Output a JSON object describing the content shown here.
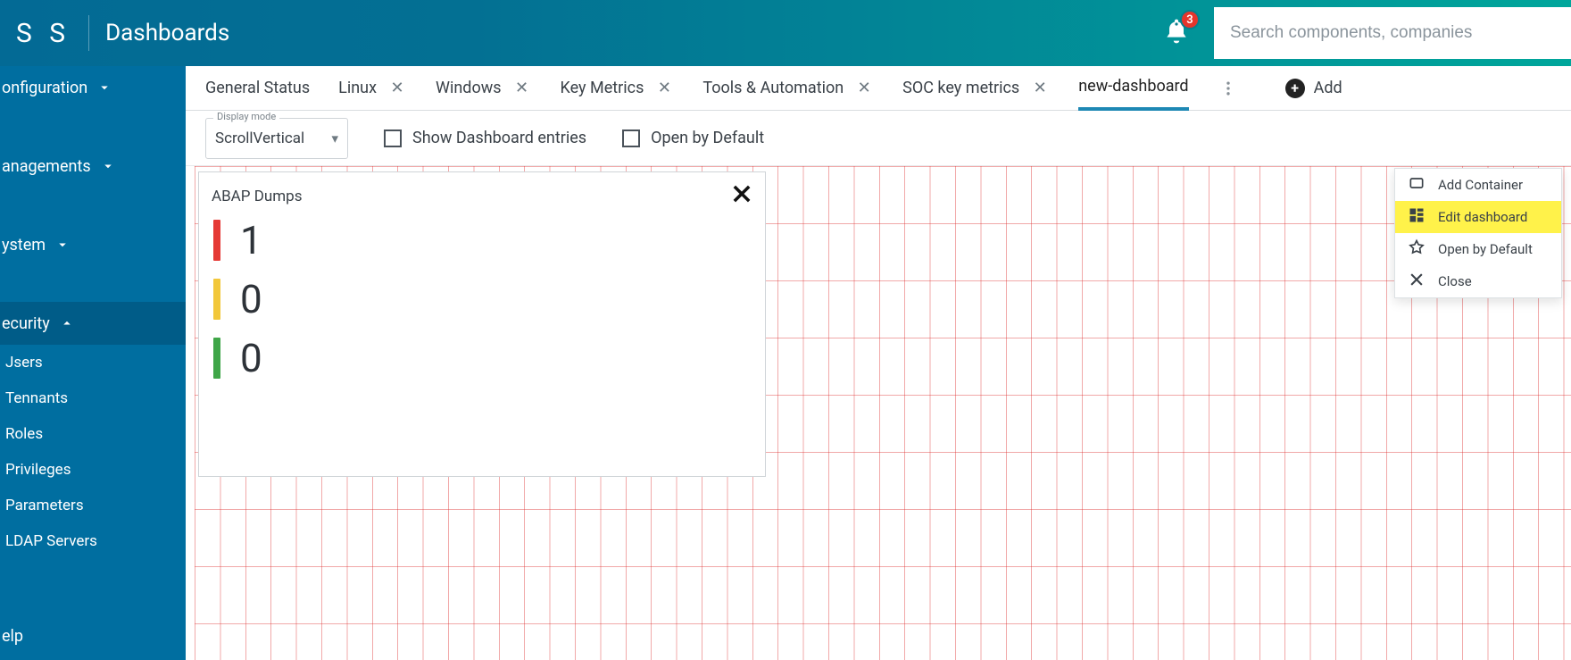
{
  "header": {
    "brand_suffix": "S S",
    "title": "Dashboards",
    "notification_count": "3",
    "search_placeholder": "Search components, companies"
  },
  "sidebar": {
    "items": [
      {
        "label": "onfiguration",
        "icon": "chev-down",
        "expanded": false
      },
      {
        "label": "anagements",
        "icon": "chev-down",
        "expanded": false
      },
      {
        "label": "ystem",
        "icon": "chev-down",
        "expanded": false
      },
      {
        "label": "ecurity",
        "icon": "chev-up",
        "expanded": true
      }
    ],
    "security_subs": [
      {
        "label": "Jsers"
      },
      {
        "label": "Tennants"
      },
      {
        "label": "Roles"
      },
      {
        "label": "Privileges"
      },
      {
        "label": "Parameters"
      },
      {
        "label": "LDAP Servers"
      }
    ],
    "help_label": "elp"
  },
  "tabs": [
    {
      "label": "General Status",
      "closable": false,
      "active": false
    },
    {
      "label": "Linux",
      "closable": true,
      "active": false
    },
    {
      "label": "Windows",
      "closable": true,
      "active": false
    },
    {
      "label": "Key Metrics",
      "closable": true,
      "active": false
    },
    {
      "label": "Tools & Automation",
      "closable": true,
      "active": false
    },
    {
      "label": "SOC key metrics",
      "closable": true,
      "active": false
    },
    {
      "label": "new-dashboard",
      "closable": false,
      "active": true
    }
  ],
  "add_label": "Add",
  "toolbar": {
    "display_mode_legend": "Display mode",
    "display_mode_value": "ScrollVertical",
    "show_entries": "Show Dashboard entries",
    "open_default": "Open by Default"
  },
  "widget": {
    "title": "ABAP Dumps",
    "rows": [
      {
        "color": "red",
        "value": "1"
      },
      {
        "color": "yellow",
        "value": "0"
      },
      {
        "color": "green",
        "value": "0"
      }
    ]
  },
  "popup": {
    "items": [
      {
        "icon": "square",
        "label": "Add Container",
        "highlight": false
      },
      {
        "icon": "grid",
        "label": "Edit dashboard",
        "highlight": true
      },
      {
        "icon": "star",
        "label": "Open by Default",
        "highlight": false
      },
      {
        "icon": "close",
        "label": "Close",
        "highlight": false
      }
    ]
  }
}
